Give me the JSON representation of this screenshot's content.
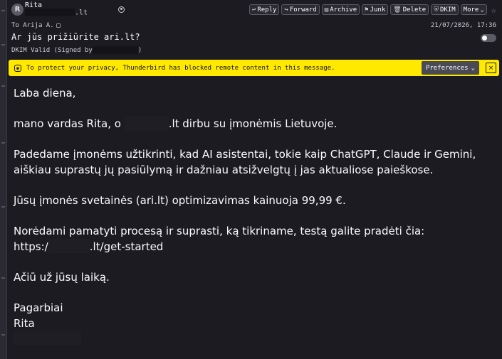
{
  "header": {
    "avatar_letter": "R",
    "sender_name": "Rita",
    "sender_email_suffix": ".lt",
    "to_label": "To",
    "to_value": "Arija A.",
    "date": "21/07/2026, 17:36",
    "subject": "Ar jūs prižiūrite ari.lt?",
    "dkim_prefix": "DKIM Valid (Signed by",
    "dkim_suffix": ")"
  },
  "toolbar": {
    "reply": "Reply",
    "forward": "Forward",
    "archive": "Archive",
    "junk": "Junk",
    "delete": "Delete",
    "dkim": "DKIM",
    "more": "More"
  },
  "notice": {
    "text": "To protect your privacy, Thunderbird has blocked remote content in this message.",
    "preferences": "Preferences",
    "close": "×"
  },
  "body": {
    "greeting": "Laba diena,",
    "intro_prefix": "mano vardas Rita, o",
    "intro_suffix": ".lt dirbu su įmonėmis Lietuvoje.",
    "para2": "Padedame įmonėms užtikrinti, kad AI asistentai, tokie kaip ChatGPT, Claude ir Gemini, aiškiau suprastų jų pasiūlymą ir dažniau atsižvelgtų į jas aktualiose paieškose.",
    "para3": "Jūsų įmonės svetainės (ari.lt) optimizavimas kainuoja 99,99 €.",
    "para4_line1": "Norėdami pamatyti procesą ir suprasti, ką tikriname, testą galite pradėti čia:",
    "link_prefix": "https:/",
    "link_suffix": ".lt/get-started",
    "thanks": "Ačiū už jūsų laiką.",
    "signoff": "Pagarbiai",
    "signature": "Rita"
  }
}
